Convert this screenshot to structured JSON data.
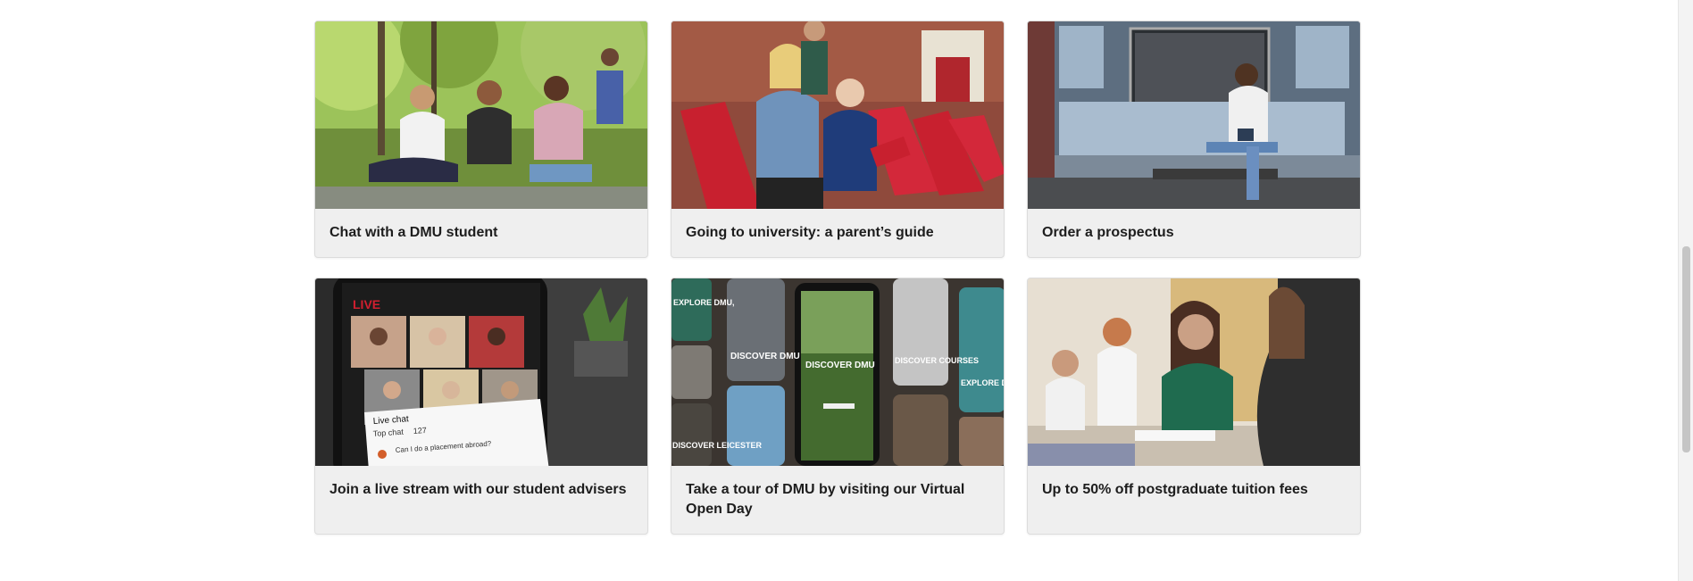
{
  "cards": [
    {
      "title": "Chat with a DMU student",
      "image": "students-sitting-on-grass-photo"
    },
    {
      "title": "Going to university: a parent’s guide",
      "image": "parent-and-student-on-deckchairs-photo"
    },
    {
      "title": "Order a prospectus",
      "image": "student-sitting-by-big-screen-photo"
    },
    {
      "title": "Join a live stream with our student advisers",
      "image": "phone-livestream-photo"
    },
    {
      "title": "Take a tour of DMU by visiting our Virtual Open Day",
      "image": "virtual-open-day-phones-photo"
    },
    {
      "title": "Up to 50% off postgraduate tuition fees",
      "image": "postgraduate-students-in-lecture-photo"
    }
  ],
  "image_text": {
    "live_badge": "LIVE",
    "live_chat": "Live chat",
    "top_chat": "Top chat",
    "viewers": "127",
    "chat_message": "Can I do a placement abroad?",
    "explore": "EXPLORE DMU,",
    "discover_dmu": "DISCOVER DMU",
    "discover_courses": "DISCOVER COURSES",
    "discover_leicester": "DISCOVER LEICESTER"
  },
  "colors": {
    "card_background": "#efefef",
    "text": "#1d1d1d",
    "dmu_red": "#d11f2f"
  }
}
